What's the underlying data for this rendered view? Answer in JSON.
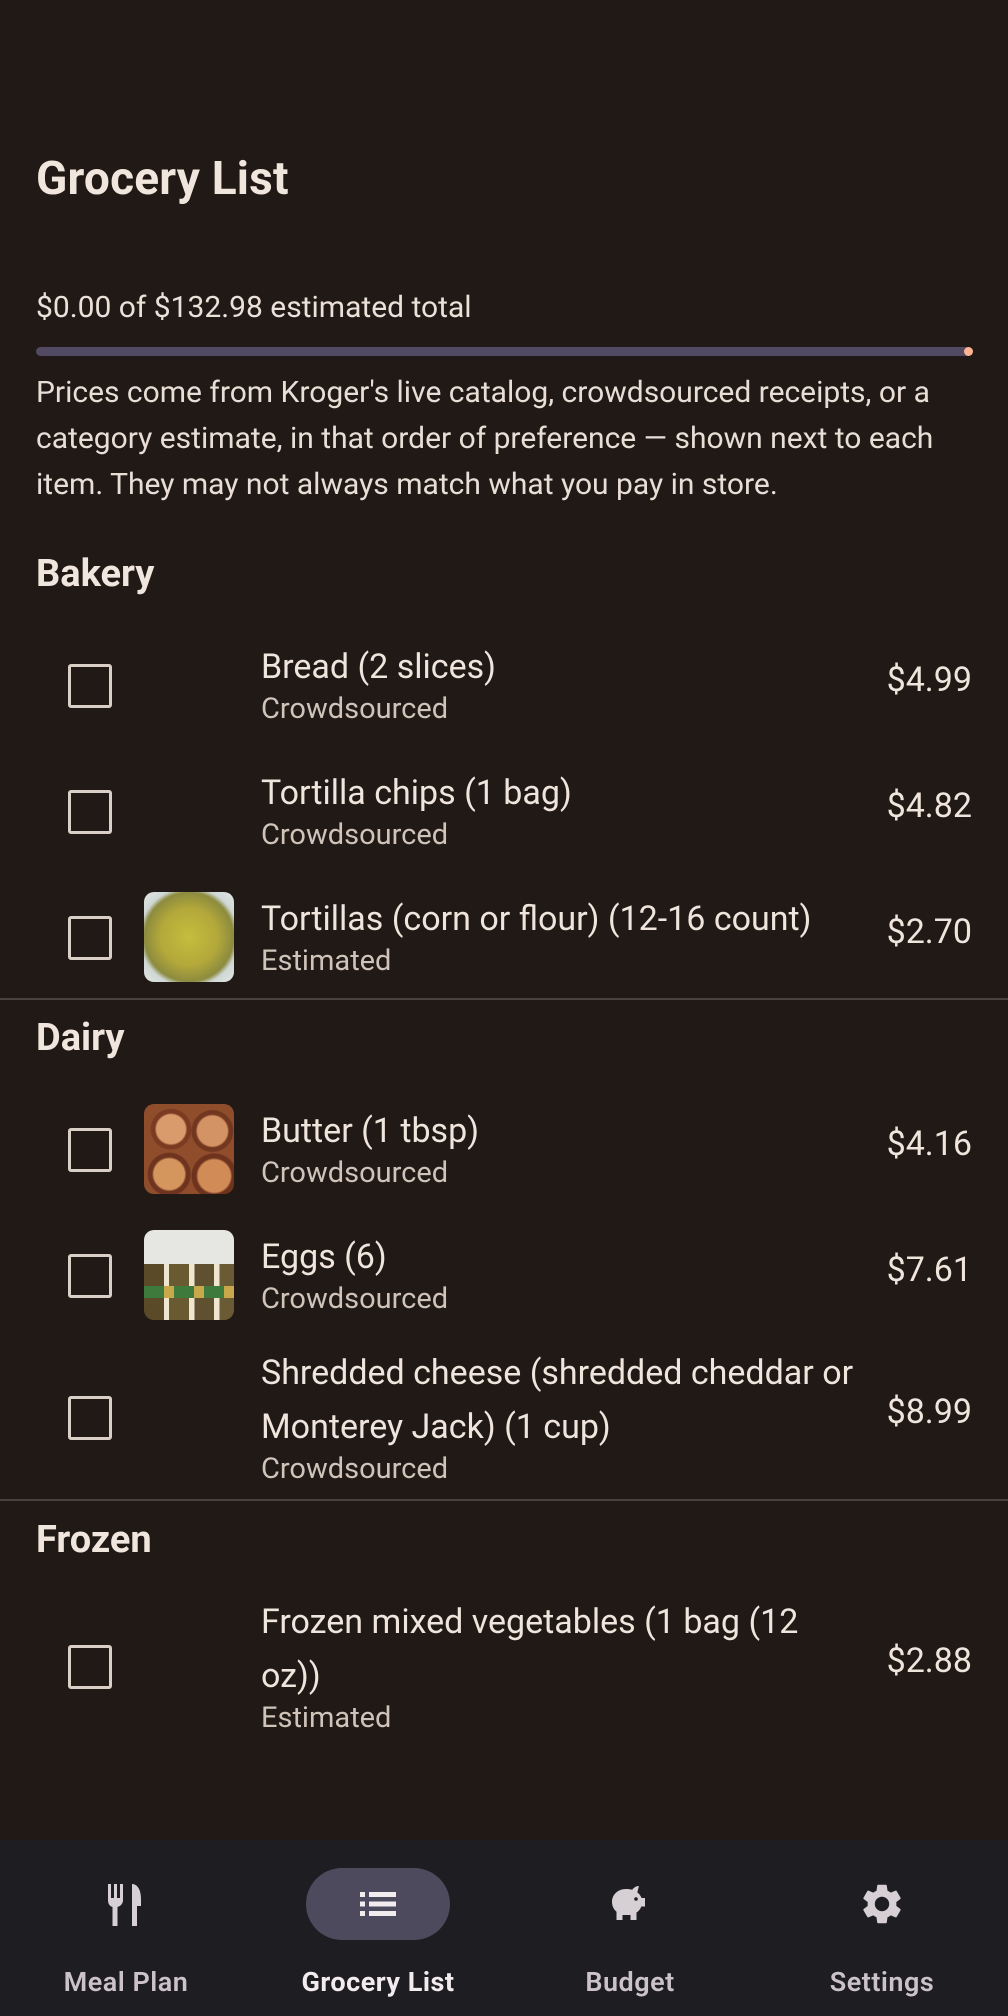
{
  "header": {
    "title": "Grocery List"
  },
  "summary": {
    "total_text": "$0.00 of $132.98 estimated total",
    "progress_fraction": 0.0,
    "info_text": "Prices come from Kroger's live catalog, crowdsourced receipts, or a category estimate, in that order of preference — shown next to each item. They may not always match what you pay in store."
  },
  "sections": [
    {
      "title": "Bakery",
      "items": [
        {
          "name": "Bread (2 slices)",
          "source": "Crowdsourced",
          "price": "$4.99",
          "checked": false
        },
        {
          "name": "Tortilla chips (1 bag)",
          "source": "Crowdsourced",
          "price": "$4.82",
          "checked": false
        },
        {
          "name": "Tortillas (corn or flour) (12-16 count)",
          "source": "Estimated",
          "price": "$2.70",
          "checked": false
        }
      ]
    },
    {
      "title": "Dairy",
      "items": [
        {
          "name": "Butter (1 tbsp)",
          "source": "Crowdsourced",
          "price": "$4.16",
          "checked": false
        },
        {
          "name": "Eggs (6)",
          "source": "Crowdsourced",
          "price": "$7.61",
          "checked": false
        },
        {
          "name": "Shredded cheese (shredded cheddar or Monterey Jack) (1 cup)",
          "source": "Crowdsourced",
          "price": "$8.99",
          "checked": false
        }
      ]
    },
    {
      "title": "Frozen",
      "items": [
        {
          "name": "Frozen mixed vegetables (1 bag (12 oz))",
          "source": "Estimated",
          "price": "$2.88",
          "checked": false
        }
      ]
    }
  ],
  "nav": {
    "items": [
      {
        "label": "Meal Plan",
        "icon": "fork-knife-icon"
      },
      {
        "label": "Grocery List",
        "icon": "list-icon",
        "active": true
      },
      {
        "label": "Budget",
        "icon": "piggy-bank-icon"
      },
      {
        "label": "Settings",
        "icon": "gear-icon"
      }
    ]
  }
}
